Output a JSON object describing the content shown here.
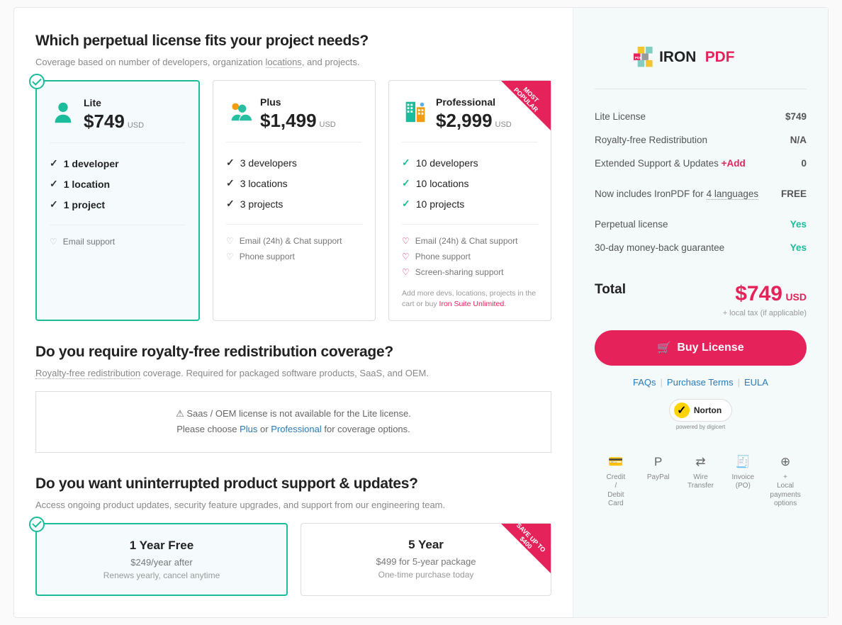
{
  "h1": "Which perpetual license fits your project needs?",
  "s1": "Coverage based on number of developers, organization ",
  "s1u": "locations",
  "s1b": ", and projects.",
  "plans": [
    {
      "name": "Lite",
      "price": "$749",
      "cur": "USD",
      "f": [
        "1 developer",
        "1 location",
        "1 project"
      ],
      "sup": [
        "Email support"
      ]
    },
    {
      "name": "Plus",
      "price": "$1,499",
      "cur": "USD",
      "f": [
        "3 developers",
        "3 locations",
        "3 projects"
      ],
      "sup": [
        "Email (24h) & Chat support",
        "Phone support"
      ]
    },
    {
      "name": "Professional",
      "price": "$2,999",
      "cur": "USD",
      "f": [
        "10 developers",
        "10 locations",
        "10 projects"
      ],
      "sup": [
        "Email (24h) & Chat support",
        "Phone support",
        "Screen-sharing support"
      ],
      "note": "Add more devs, locations, projects in the cart or buy ",
      "notelink": "Iron Suite Unlimited",
      "ribbon": "MOST POPULAR"
    }
  ],
  "h2": "Do you require royalty-free redistribution coverage?",
  "s2a": "Royalty-free redistribution",
  "s2b": " coverage. Required for packaged software products, SaaS, and OEM.",
  "alert1": "⚠ Saas / OEM license is not available for the Lite license.",
  "alert2a": "Please choose ",
  "alert2b": "Plus",
  "alert2c": " or ",
  "alert2d": "Professional",
  "alert2e": " for coverage options.",
  "h3": "Do you want uninterrupted product support & updates?",
  "s3": "Access ongoing product updates, security feature upgrades, and support from our engineering team.",
  "sup": [
    {
      "t": "1 Year Free",
      "p": "$249/year after",
      "d": "Renews yearly, cancel anytime"
    },
    {
      "t": "5 Year",
      "p": "$499 for 5-year package",
      "d": "One-time purchase today",
      "ribbon": "SAVE UP TO $400"
    }
  ],
  "sum": [
    {
      "l": "Lite License",
      "v": "$749"
    },
    {
      "l": "Royalty-free Redistribution",
      "v": "N/A"
    },
    {
      "l": "Extended Support & Updates",
      "add": "+Add",
      "v": "0"
    },
    {
      "l": "Now includes IronPDF for ",
      "u": "4 languages",
      "v": "FREE"
    },
    {
      "l": "Perpetual license",
      "v": "Yes",
      "grn": true
    },
    {
      "l": "30-day money-back guarantee",
      "v": "Yes",
      "grn": true
    }
  ],
  "totl": "Total",
  "totp": "$749",
  "totc": "USD",
  "tax": "+ local tax (if applicable)",
  "buy": "Buy License",
  "links": [
    "FAQs",
    "Purchase Terms",
    "EULA"
  ],
  "norton": "Norton",
  "nby": "powered by digicert",
  "pay": [
    [
      "💳",
      "Credit / Debit Card"
    ],
    [
      "P",
      "PayPal"
    ],
    [
      "⇄",
      "Wire Transfer"
    ],
    [
      "🧾",
      "Invoice (PO)"
    ],
    [
      "⊕",
      "+ Local payments options"
    ]
  ]
}
